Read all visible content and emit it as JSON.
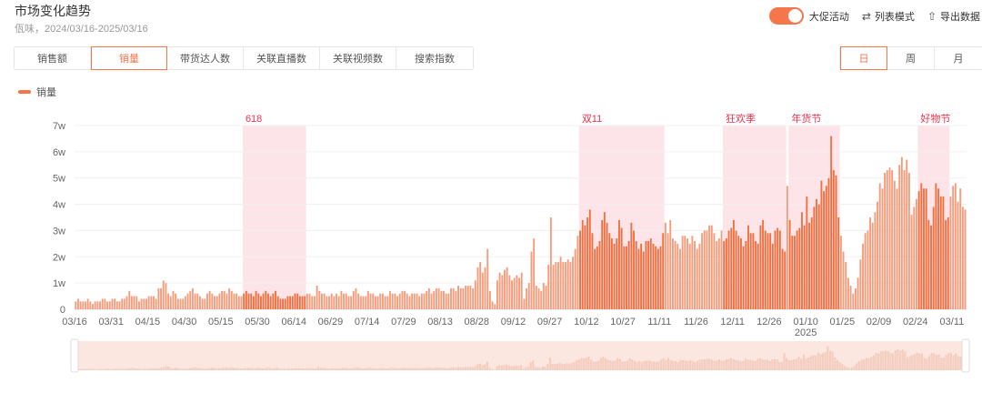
{
  "header": {
    "title": "市场变化趋势",
    "subtitle": "佤味，2024/03/16-2025/03/16"
  },
  "toolbar": {
    "promo_toggle_label": "大促活动",
    "promo_toggle_on": true,
    "list_mode_label": "列表模式",
    "export_label": "导出数据"
  },
  "metric_tabs": [
    {
      "label": "销售额",
      "active": false
    },
    {
      "label": "销量",
      "active": true
    },
    {
      "label": "带货达人数",
      "active": false
    },
    {
      "label": "关联直播数",
      "active": false
    },
    {
      "label": "关联视频数",
      "active": false
    },
    {
      "label": "搜索指数",
      "active": false
    }
  ],
  "granularity_tabs": [
    {
      "label": "日",
      "active": true
    },
    {
      "label": "周",
      "active": false
    },
    {
      "label": "月",
      "active": false
    }
  ],
  "colors": {
    "accent": "#f4764a",
    "bar": "#f89b7b",
    "bar_promo": "#f2703f",
    "band": "#fde4e8",
    "band_label": "#e8344e"
  },
  "chart_data": {
    "type": "bar",
    "legend": [
      "销量"
    ],
    "legend_position": "top-left",
    "ylabel": "",
    "xlabel": "",
    "ylim": [
      0,
      7
    ],
    "y_unit": "w",
    "y_ticks": [
      "0",
      "1w",
      "2w",
      "3w",
      "4w",
      "5w",
      "6w",
      "7w"
    ],
    "x_ticks": [
      {
        "day": 0,
        "label": "03/16"
      },
      {
        "day": 15,
        "label": "03/31"
      },
      {
        "day": 30,
        "label": "04/15"
      },
      {
        "day": 45,
        "label": "04/30"
      },
      {
        "day": 60,
        "label": "05/15"
      },
      {
        "day": 75,
        "label": "05/30"
      },
      {
        "day": 90,
        "label": "06/14"
      },
      {
        "day": 105,
        "label": "06/29"
      },
      {
        "day": 120,
        "label": "07/14"
      },
      {
        "day": 135,
        "label": "07/29"
      },
      {
        "day": 150,
        "label": "08/13"
      },
      {
        "day": 165,
        "label": "08/28"
      },
      {
        "day": 180,
        "label": "09/12"
      },
      {
        "day": 195,
        "label": "09/27"
      },
      {
        "day": 210,
        "label": "10/12"
      },
      {
        "day": 225,
        "label": "10/27"
      },
      {
        "day": 240,
        "label": "11/11"
      },
      {
        "day": 255,
        "label": "11/26"
      },
      {
        "day": 270,
        "label": "12/11"
      },
      {
        "day": 285,
        "label": "12/26"
      },
      {
        "day": 300,
        "label": "01/10",
        "sub": "2025"
      },
      {
        "day": 315,
        "label": "01/25"
      },
      {
        "day": 330,
        "label": "02/09"
      },
      {
        "day": 345,
        "label": "02/24"
      },
      {
        "day": 360,
        "label": "03/11"
      }
    ],
    "promotions": [
      {
        "name": "618",
        "start": 69,
        "end": 94
      },
      {
        "name": "双11",
        "start": 207,
        "end": 241
      },
      {
        "name": "狂欢季",
        "start": 266,
        "end": 291
      },
      {
        "name": "年货节",
        "start": 293,
        "end": 313
      },
      {
        "name": "好物节",
        "start": 346,
        "end": 358
      }
    ],
    "values": [
      0.3,
      0.4,
      0.3,
      0.3,
      0.3,
      0.4,
      0.3,
      0.2,
      0.3,
      0.3,
      0.3,
      0.4,
      0.4,
      0.3,
      0.3,
      0.4,
      0.4,
      0.3,
      0.3,
      0.4,
      0.4,
      0.5,
      0.7,
      0.5,
      0.5,
      0.5,
      0.3,
      0.4,
      0.4,
      0.4,
      0.5,
      0.5,
      0.5,
      0.4,
      0.8,
      0.8,
      1.1,
      1.0,
      0.6,
      0.5,
      0.7,
      0.6,
      0.4,
      0.4,
      0.4,
      0.5,
      0.6,
      0.7,
      0.8,
      0.6,
      0.6,
      0.5,
      0.4,
      0.4,
      0.6,
      0.7,
      0.6,
      0.5,
      0.5,
      0.6,
      0.7,
      0.7,
      0.6,
      0.8,
      0.7,
      0.6,
      0.6,
      0.5,
      0.5,
      0.6,
      0.7,
      0.6,
      0.6,
      0.5,
      0.7,
      0.6,
      0.5,
      0.6,
      0.7,
      0.6,
      0.5,
      0.6,
      0.7,
      0.5,
      0.4,
      0.4,
      0.4,
      0.5,
      0.5,
      0.5,
      0.6,
      0.6,
      0.5,
      0.5,
      0.5,
      0.6,
      0.6,
      0.5,
      0.5,
      0.9,
      0.7,
      0.6,
      0.6,
      0.5,
      0.5,
      0.6,
      0.5,
      0.6,
      0.5,
      0.7,
      0.6,
      0.6,
      0.5,
      0.5,
      0.7,
      0.8,
      0.6,
      0.5,
      0.5,
      0.5,
      0.7,
      0.6,
      0.6,
      0.5,
      0.5,
      0.6,
      0.6,
      0.5,
      0.5,
      0.7,
      0.6,
      0.6,
      0.5,
      0.6,
      0.7,
      0.7,
      0.6,
      0.5,
      0.6,
      0.6,
      0.6,
      0.5,
      0.6,
      0.6,
      0.7,
      0.8,
      0.6,
      0.7,
      0.8,
      0.8,
      0.7,
      0.7,
      0.6,
      0.6,
      0.8,
      0.8,
      0.7,
      0.9,
      0.8,
      0.8,
      0.9,
      0.9,
      0.9,
      0.8,
      1.1,
      1.6,
      1.8,
      1.4,
      1.6,
      2.3,
      0.7,
      0.3,
      0.2,
      1.1,
      1.4,
      1.3,
      1.5,
      1.6,
      1.3,
      1.1,
      1.2,
      1.3,
      1.2,
      1.4,
      0.4,
      0.8,
      1.0,
      2.2,
      2.7,
      0.9,
      0.8,
      0.7,
      1.0,
      0.9,
      1.7,
      3.5,
      1.7,
      1.8,
      1.8,
      2.0,
      1.8,
      1.8,
      1.9,
      1.8,
      2.0,
      2.3,
      2.8,
      3.0,
      3.4,
      3.2,
      3.5,
      3.8,
      2.9,
      2.3,
      2.4,
      2.6,
      3.4,
      3.7,
      3.3,
      2.9,
      2.7,
      2.5,
      2.7,
      3.4,
      3.1,
      2.4,
      2.4,
      2.6,
      3.3,
      3.0,
      2.6,
      2.3,
      2.5,
      2.2,
      2.6,
      2.6,
      2.7,
      2.5,
      2.4,
      2.3,
      2.4,
      2.9,
      3.3,
      2.9,
      3.4,
      2.7,
      2.6,
      2.5,
      2.3,
      2.8,
      2.8,
      2.7,
      2.5,
      2.8,
      2.6,
      2.3,
      2.5,
      2.9,
      3.0,
      3.0,
      3.2,
      3.2,
      2.9,
      2.6,
      2.7,
      3.0,
      2.6,
      2.7,
      3.0,
      3.1,
      3.4,
      3.0,
      2.8,
      2.7,
      2.4,
      2.6,
      3.2,
      2.9,
      2.9,
      2.6,
      2.5,
      3.2,
      3.4,
      3.0,
      2.9,
      2.9,
      2.5,
      3.0,
      3.1,
      3.0,
      2.3,
      2.2,
      4.7,
      3.4,
      2.8,
      2.8,
      3.0,
      3.1,
      3.7,
      3.2,
      4.3,
      3.3,
      3.5,
      3.9,
      4.2,
      4.0,
      4.9,
      4.5,
      4.7,
      5.0,
      6.6,
      5.3,
      5.1,
      3.5,
      2.8,
      2.2,
      1.8,
      1.2,
      0.9,
      0.6,
      0.8,
      1.2,
      1.9,
      2.5,
      2.9,
      3.0,
      3.5,
      3.3,
      3.7,
      4.1,
      4.8,
      4.6,
      5.2,
      5.3,
      5.4,
      5.3,
      4.9,
      4.6,
      5.5,
      5.8,
      5.3,
      5.7,
      5.2,
      3.6,
      3.9,
      4.2,
      4.5,
      4.8,
      4.6,
      4.6,
      3.4,
      3.2,
      3.9,
      4.8,
      4.6,
      4.3,
      4.3,
      3.4,
      3.5,
      4.3,
      4.7,
      4.8,
      4.1,
      4.6,
      3.9,
      3.8
    ]
  }
}
